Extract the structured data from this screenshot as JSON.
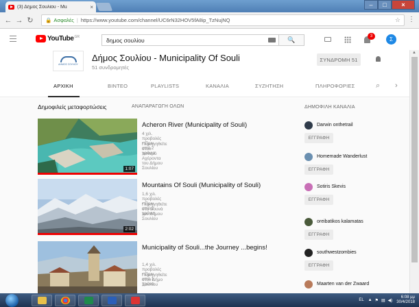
{
  "browser": {
    "tab_title": "(3) Δήμος Σουλίου - Mu",
    "tab_close": "×",
    "secure_label": "Ασφαλές",
    "url": "https://www.youtube.com/channel/UC6rN32HOV5fA8ip_TzNujNQ",
    "separator": "|"
  },
  "youtube": {
    "logo_text": "YouTube",
    "logo_country": "GR",
    "search_value": "δημος σουλίου",
    "notification_count": "3",
    "avatar_letter": "Σ"
  },
  "channel": {
    "name": "Δήμος Σουλίου - Municipality Of Souli",
    "subscribers": "51 συνδρομητές",
    "subscribe_label": "ΣΥΝΔΡΟΜΗ 51",
    "logo_text": "ΔΗΜΟΣ ΣΟΥΛΙΟΥ",
    "tabs": [
      "ΑΡΧΙΚΗ",
      "ΒΙΝΤΕΟ",
      "PLAYLISTS",
      "ΚΑΝΑΛΙΑ",
      "ΣΥΖΗΤΗΣΗ",
      "ΠΛΗΡΟΦΟΡΙΕΣ"
    ],
    "active_tab": "ΑΡΧΙΚΗ"
  },
  "section": {
    "title": "Δημοφιλείς μεταφορτώσεις",
    "play_all": "ΑΝΑΠΑΡΑΓΩΓΗ ΟΛΩΝ"
  },
  "videos": [
    {
      "title": "Acheron River (Municipality of Souli)",
      "meta": "4 χιλ. προβολές • Πριν από 2 χρόνια",
      "desc": "Περιηγηθείτε στον ποταμό Αχέροντα του Δήμου Σουλίου",
      "duration": "1:07",
      "watched": 1.0
    },
    {
      "title": "Mountains Of Souli (Municipality of Souli)",
      "meta": "1,6 χιλ. προβολές • Πριν από 2 χρόνια",
      "desc": "Περιηγηθείτε στα Βουνά του Δήμου Σουλίου",
      "duration": "2:02",
      "watched": 1.0
    },
    {
      "title": "Municipality of Souli...the Journey ...begins!",
      "meta": "1,4 χιλ. προβολές • Πριν από 1 χρόνο",
      "desc": "Περιηγηθείτε στον Δήμο Σουλίου",
      "duration": "",
      "watched": 0
    }
  ],
  "sidebar": {
    "title": "ΔΗΜΟΦΙΛΗ ΚΑΝΑΛΙΑ",
    "subscribe_label": "ΕΓΓΡΑΦΗ",
    "channels": [
      {
        "name": "Darwin onthetrail",
        "color": "#2f3b4a"
      },
      {
        "name": "Homemade Wanderlust",
        "color": "#6a8fb0"
      },
      {
        "name": "Sotiris Skevis",
        "color": "#c86fb6"
      },
      {
        "name": "oreibatikos kalamatas",
        "color": "#4a5a3a"
      },
      {
        "name": "southwestzombies",
        "color": "#222222"
      },
      {
        "name": "Maarten van der Zwaard",
        "color": "#b87a5a"
      }
    ]
  },
  "taskbar": {
    "language": "EL",
    "time": "6:08 μμ",
    "date": "30/4/2018"
  },
  "colors": {
    "youtube_red": "#ff0000",
    "accent_blue": "#1e88e5"
  }
}
